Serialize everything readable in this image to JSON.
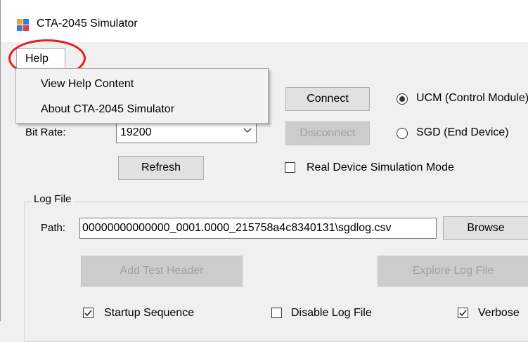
{
  "window": {
    "title": "CTA-2045 Simulator",
    "icon": "app-window-icon"
  },
  "menu": {
    "help_label": "Help",
    "help_items": [
      "View Help Content",
      "About CTA-2045 Simulator"
    ]
  },
  "connection": {
    "bit_rate_label": "Bit Rate:",
    "bit_rate_value": "19200",
    "connect_label": "Connect",
    "disconnect_label": "Disconnect",
    "refresh_label": "Refresh",
    "ucm_label": "UCM (Control Module)",
    "sgd_label": "SGD (End Device)",
    "real_device_label": "Real Device Simulation Mode",
    "ucm_selected": true,
    "real_device_checked": false
  },
  "log_file": {
    "group_label": "Log File",
    "path_label": "Path:",
    "path_value": "00000000000000_0001.0000_215758a4c8340131\\sgdlog.csv",
    "browse_label": "Browse",
    "add_header_label": "Add Test Header",
    "explore_label": "Explore Log File",
    "startup_label": "Startup Sequence",
    "disable_label": "Disable Log File",
    "verbose_label": "Verbose",
    "startup_checked": true,
    "disable_checked": false,
    "verbose_checked": true
  },
  "colors": {
    "highlight_circle": "#e21f1f",
    "window_bg": "#f0f0f0"
  }
}
